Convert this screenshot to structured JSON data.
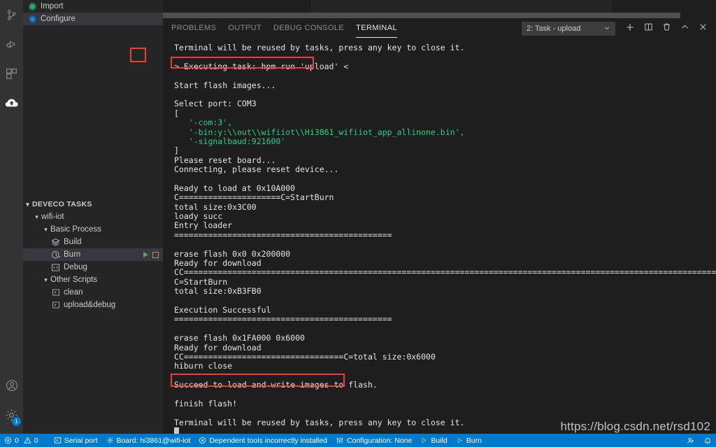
{
  "activitybar": {
    "items": [
      {
        "name": "source-control-icon",
        "title": "Source Control",
        "active": false
      },
      {
        "name": "run-and-debug-icon",
        "title": "Run and Debug",
        "active": false
      },
      {
        "name": "extensions-icon",
        "title": "Extensions",
        "active": false
      },
      {
        "name": "deveco-cloud-icon",
        "title": "DevEco",
        "active": true
      }
    ],
    "bottom": [
      {
        "name": "account-icon",
        "title": "Accounts",
        "badge": ""
      },
      {
        "name": "settings-gear-icon",
        "title": "Manage",
        "badge": "1"
      }
    ]
  },
  "sidebar": {
    "top_items": [
      {
        "label": "Import",
        "icon": "green-circle-icon",
        "selected": false
      },
      {
        "label": "Configure",
        "icon": "blue-circle-icon",
        "selected": true
      }
    ],
    "tasks": {
      "header": "DEVECO TASKS",
      "project": "wifi-iot",
      "groups": [
        {
          "label": "Basic Process",
          "items": [
            "Build",
            "Burn",
            "Debug"
          ]
        },
        {
          "label": "Other Scripts",
          "items": [
            "clean",
            "upload&debug"
          ]
        }
      ],
      "selected_item": "Burn",
      "row_actions": {
        "run": "run-task-icon",
        "stop": "stop-task-icon"
      }
    }
  },
  "panel": {
    "tabs": [
      {
        "label": "PROBLEMS",
        "active": false
      },
      {
        "label": "OUTPUT",
        "active": false
      },
      {
        "label": "DEBUG CONSOLE",
        "active": false
      },
      {
        "label": "TERMINAL",
        "active": true
      }
    ],
    "terminal_select": {
      "value": "2: Task - upload",
      "chevron": "chevron-down-icon"
    },
    "actions": [
      {
        "name": "new-terminal-icon",
        "glyph": "plus"
      },
      {
        "name": "split-terminal-icon",
        "glyph": "split"
      },
      {
        "name": "kill-terminal-icon",
        "glyph": "trash"
      },
      {
        "name": "maximize-panel-icon",
        "glyph": "chevron-up"
      },
      {
        "name": "close-panel-icon",
        "glyph": "close"
      }
    ]
  },
  "terminal": {
    "lines": [
      {
        "text": "Terminal will be reused by tasks, press any key to close it.",
        "color": "white"
      },
      {
        "text": "",
        "color": "white"
      },
      {
        "text": "> Executing task: hpm run 'upload' <",
        "color": "white",
        "highlight": true
      },
      {
        "text": "",
        "color": "white"
      },
      {
        "text": "Start flash images...",
        "color": "white"
      },
      {
        "text": "",
        "color": "white"
      },
      {
        "text": "Select port: COM3",
        "color": "white"
      },
      {
        "text": "[",
        "color": "white"
      },
      {
        "text": "   '-com:3',",
        "color": "green"
      },
      {
        "text": "   '-bin:y:\\\\out\\\\wifiiot\\\\Hi3861_wifiiot_app_allinone.bin',",
        "color": "green"
      },
      {
        "text": "   '-signalbaud:921600'",
        "color": "green"
      },
      {
        "text": "]",
        "color": "white"
      },
      {
        "text": "Please reset board...",
        "color": "white"
      },
      {
        "text": "Connecting, please reset device...",
        "color": "white"
      },
      {
        "text": "",
        "color": "white"
      },
      {
        "text": "Ready to load at 0x10A000",
        "color": "white"
      },
      {
        "text": "C=====================C=StartBurn",
        "color": "white"
      },
      {
        "text": "total size:0x3C00",
        "color": "white"
      },
      {
        "text": "loady succ",
        "color": "white"
      },
      {
        "text": "Entry loader",
        "color": "white"
      },
      {
        "text": "=============================================",
        "color": "white"
      },
      {
        "text": "",
        "color": "white"
      },
      {
        "text": "erase flash 0x0 0x200000",
        "color": "white"
      },
      {
        "text": "Ready for download",
        "color": "white"
      },
      {
        "text": "CC===========================================================================================================================================================================================",
        "color": "white"
      },
      {
        "text": "C=StartBurn",
        "color": "white"
      },
      {
        "text": "total size:0xB3FB0",
        "color": "white"
      },
      {
        "text": "",
        "color": "white"
      },
      {
        "text": "Execution Successful",
        "color": "white"
      },
      {
        "text": "=============================================",
        "color": "white"
      },
      {
        "text": "",
        "color": "white"
      },
      {
        "text": "erase flash 0x1FA000 0x6000",
        "color": "white"
      },
      {
        "text": "Ready for download",
        "color": "white"
      },
      {
        "text": "CC=================================C=total size:0x6000",
        "color": "white"
      },
      {
        "text": "hiburn close",
        "color": "white"
      },
      {
        "text": "",
        "color": "white"
      },
      {
        "text": "Succeed to load and write images to flash.",
        "color": "white",
        "highlight": true
      },
      {
        "text": "",
        "color": "white"
      },
      {
        "text": "finish flash!",
        "color": "white"
      },
      {
        "text": "",
        "color": "white"
      },
      {
        "text": "Terminal will be reused by tasks, press any key to close it.",
        "color": "white"
      }
    ],
    "cursor": "block-cursor"
  },
  "statusbar": {
    "left": [
      {
        "name": "problems-status",
        "icon": "error-icon",
        "label": "0",
        "icon2": "warning-icon",
        "label2": "0"
      },
      {
        "name": "serial-port-status",
        "icon": "terminal-icon",
        "label": "Serial port"
      },
      {
        "name": "board-status",
        "icon": "gear-icon",
        "label": "Board: hi3861@wifi-iot"
      },
      {
        "name": "dependent-tools-status",
        "icon": "error-circle-icon",
        "label": "Dependent tools incorrectly installed"
      },
      {
        "name": "configuration-status",
        "icon": "sliders-icon",
        "label": "Configuration: None"
      },
      {
        "name": "build-status",
        "icon": "play-icon",
        "label": "Build"
      },
      {
        "name": "burn-status",
        "icon": "play-icon",
        "label": "Burn"
      }
    ],
    "right": [
      {
        "name": "live-share-icon",
        "label": ""
      },
      {
        "name": "notifications-bell-icon",
        "label": ""
      }
    ]
  },
  "watermark": {
    "text": "https://blog.csdn.net/rsd102"
  },
  "colors": {
    "accent": "#007acc",
    "highlight_box": "#e8413a",
    "terminal_green": "#23d18b",
    "play_green": "#4caf50",
    "panel_bg": "#1e1e1e",
    "sidebar_bg": "#252526",
    "activitybar_bg": "#333333",
    "selection_bg": "#37373d"
  }
}
